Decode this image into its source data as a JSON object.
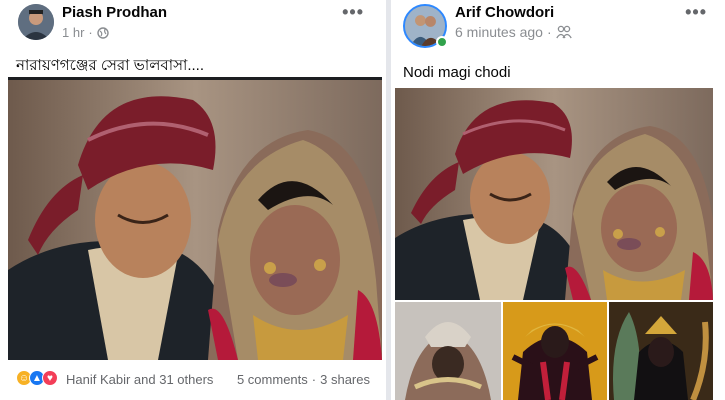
{
  "left_post": {
    "author": "Piash Prodhan",
    "time": "1 hr",
    "separator": "·",
    "privacy_icon": "public-globe-icon",
    "more_icon": "more-options-icon",
    "caption": "নারায়ণগঞ্জের সেরা ভালবাসা....",
    "reactions": {
      "icons": [
        "haha-reaction-icon",
        "like-reaction-icon",
        "love-reaction-icon"
      ],
      "names": "Hanif Kabir and 31 others"
    },
    "comments": "5 comments",
    "dot": "·",
    "shares": "3 shares"
  },
  "right_post": {
    "author": "Arif Chowdori",
    "time": "6 minutes ago",
    "separator": "·",
    "privacy_icon": "friends-icon",
    "more_icon": "more-options-icon",
    "online_status_color": "#31a24c",
    "caption": "Nodi magi chodi"
  },
  "colors": {
    "background": "#e4e6eb",
    "card": "#ffffff",
    "secondary_text": "#65676b",
    "like_blue": "#1877f2",
    "love_red": "#f33e58",
    "haha_yellow": "#f7b125"
  }
}
